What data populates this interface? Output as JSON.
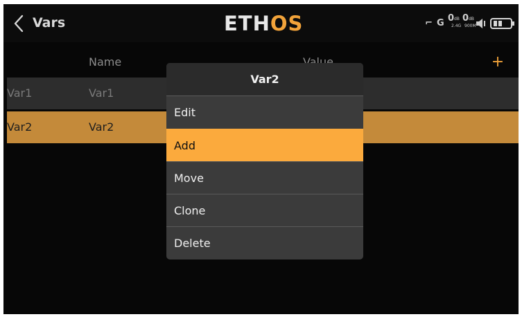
{
  "header": {
    "title": "Vars",
    "logo_main": "ETH",
    "logo_accent": "OS",
    "status": {
      "rx1_label": "0",
      "rx1_unit": "dB",
      "rx1_band": "2.4G",
      "rx2_label": "0",
      "rx2_unit": "dB",
      "rx2_band": "900M"
    }
  },
  "table": {
    "columns": [
      "Name",
      "Value"
    ],
    "add_label": "+",
    "rows": [
      {
        "id": "Var1",
        "name": "Var1"
      },
      {
        "id": "Var2",
        "name": "Var2"
      }
    ]
  },
  "menu": {
    "title": "Var2",
    "items": [
      "Edit",
      "Add",
      "Move",
      "Clone",
      "Delete"
    ],
    "selected": "Add"
  },
  "colors": {
    "accent": "#f2a33a",
    "selected_item": "#fbaa3d",
    "selected_row": "#c48a3a"
  }
}
